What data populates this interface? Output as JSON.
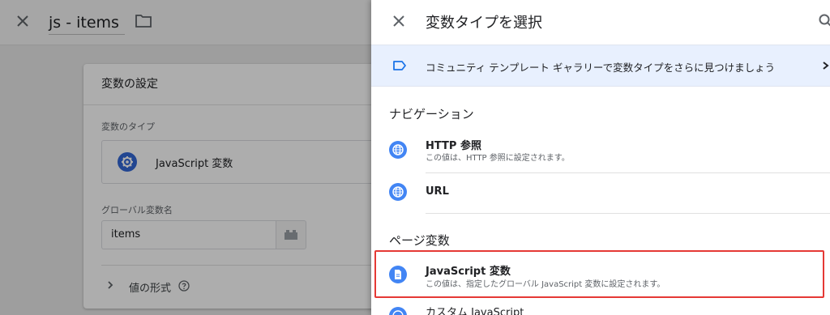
{
  "background": {
    "header": {
      "title": "js - items",
      "close_icon": "close-icon",
      "folder_icon": "folder-icon"
    },
    "card": {
      "title": "変数の設定",
      "variable_type_label": "変数のタイプ",
      "variable_type_value": "JavaScript 変数",
      "variable_type_icon": "gear-icon",
      "global_variable_label": "グローバル変数名",
      "global_variable_value": "items",
      "global_variable_button_icon": "brick-icon",
      "format_label": "値の形式",
      "format_help_icon": "help-icon"
    }
  },
  "panel": {
    "title": "変数タイプを選択",
    "banner": {
      "text": "コミュニティ テンプレート ギャラリーで変数タイプをさらに見つけましょう"
    },
    "sections": [
      {
        "heading": "ナビゲーション",
        "items": [
          {
            "title": "HTTP 参照",
            "description": "この値は、HTTP 参照に設定されます。",
            "icon": "globe-icon"
          },
          {
            "title": "URL",
            "description": "",
            "icon": "globe-icon"
          }
        ]
      },
      {
        "heading": "ページ変数",
        "items": [
          {
            "title": "JavaScript 変数",
            "description": "この値は、指定したグローバル JavaScript 変数に設定されます。",
            "icon": "document-icon",
            "highlighted": true
          },
          {
            "title": "カスタム JavaScript",
            "description": "",
            "icon": "globe-icon"
          }
        ]
      }
    ]
  },
  "colors": {
    "accent": "#4285f4",
    "banner_bg": "#e8f0fe",
    "highlight": "#e53935"
  }
}
